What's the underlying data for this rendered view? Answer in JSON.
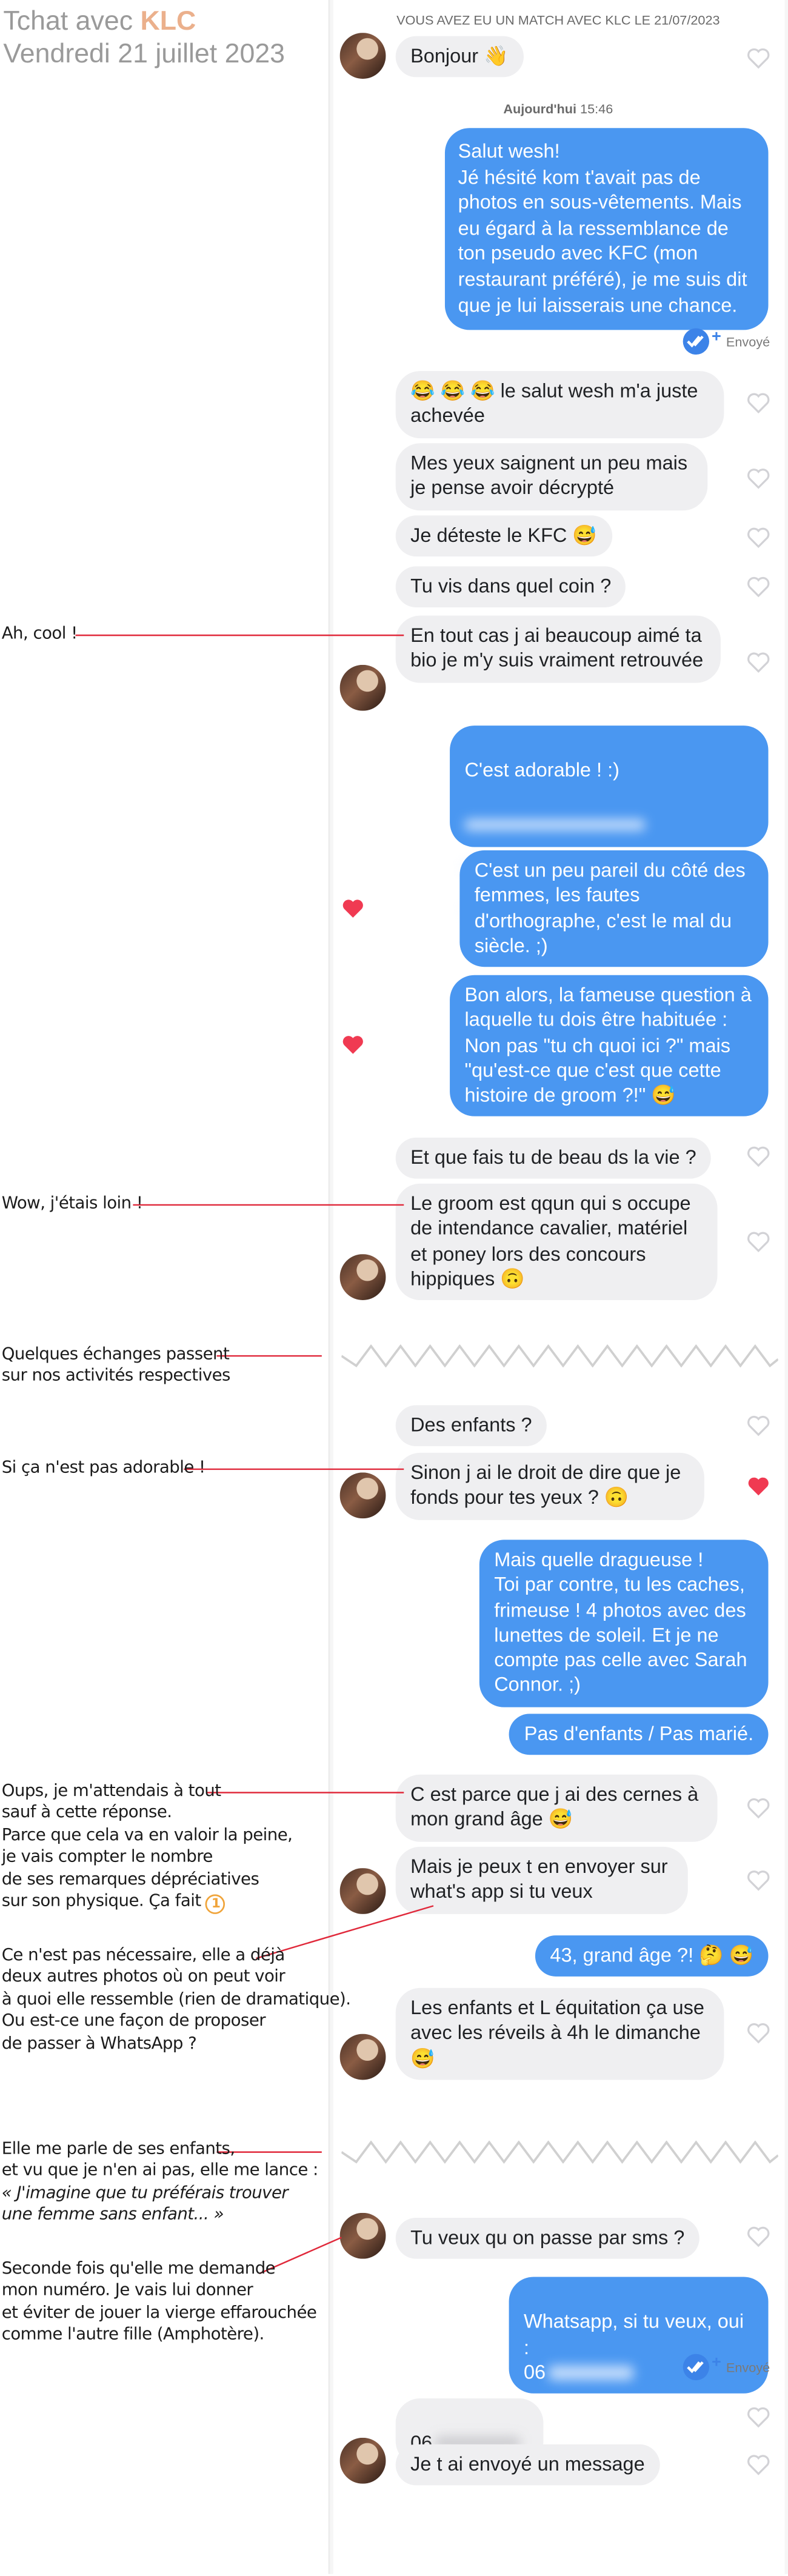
{
  "header": {
    "title_prefix": "Tchat avec",
    "title_name": "KLC",
    "date": "Vendredi 21 juillet 2023"
  },
  "chat": {
    "match_notice": "VOUS AVEZ EU UN MATCH AVEC KLC LE 21/07/2023",
    "today_label": "Aujourd'hui",
    "today_time": "15:46",
    "sent_status": "Envoyé",
    "messages": [
      {
        "dir": "in",
        "text": "Bonjour 👋"
      },
      {
        "dir": "out",
        "text": "Salut wesh!\nJé hésité kom t'avait pas de photos en sous-vêtements. Mais eu égard à la ressemblance de ton pseudo avec KFC (mon restaurant préféré), je me suis dit que je lui laisserais une chance."
      },
      {
        "dir": "in",
        "text": "😂 😂 😂 le salut wesh m'a juste achevée"
      },
      {
        "dir": "in",
        "text": "Mes yeux saignent un peu mais je pense avoir décrypté"
      },
      {
        "dir": "in",
        "text": "Je déteste le KFC 😅"
      },
      {
        "dir": "in",
        "text": "Tu vis dans quel coin ?"
      },
      {
        "dir": "in",
        "text": "En tout cas j ai beaucoup aimé ta bio je m'y suis vraiment retrouvée"
      },
      {
        "dir": "out",
        "text": "C'est adorable ! :)"
      },
      {
        "dir": "out",
        "text": "C'est un peu pareil du côté des femmes, les fautes d'orthographe, c'est le mal du siècle. ;)"
      },
      {
        "dir": "out",
        "text": "Bon alors, la fameuse question à laquelle tu dois être habituée : Non pas \"tu ch quoi ici ?\" mais \"qu'est-ce que c'est que cette histoire de groom ?!\" 😅"
      },
      {
        "dir": "in",
        "text": "Et que fais tu de beau ds la vie ?"
      },
      {
        "dir": "in",
        "text": "Le groom est qqun qui s occupe de intendance cavalier,  matériel et poney lors des concours hippiques 🙃"
      },
      {
        "dir": "in",
        "text": "Des enfants ?"
      },
      {
        "dir": "in",
        "text": "Sinon j ai le droit de dire que je fonds pour tes yeux ? 🙃"
      },
      {
        "dir": "out",
        "text": "Mais quelle dragueuse !\nToi par contre, tu les caches, frimeuse ! 4 photos avec des lunettes de soleil. Et je ne compte pas celle avec Sarah Connor. ;)"
      },
      {
        "dir": "out",
        "text": "Pas d'enfants / Pas marié."
      },
      {
        "dir": "in",
        "text": "C est parce que j ai des cernes à mon grand âge 😅"
      },
      {
        "dir": "in",
        "text": "Mais je peux t en envoyer sur what's app si tu veux"
      },
      {
        "dir": "out",
        "text": "43, grand âge ?! 🤔 😅"
      },
      {
        "dir": "in",
        "text": "Les enfants et L équitation ça use avec les réveils à 4h le dimanche 😅"
      },
      {
        "dir": "in",
        "text": "Tu veux qu on passe par sms ?"
      },
      {
        "dir": "out",
        "text": "Whatsapp, si tu veux, oui :\n06"
      },
      {
        "dir": "in",
        "text": "06"
      },
      {
        "dir": "in",
        "text": "Je t ai envoyé un message"
      }
    ]
  },
  "annotations": [
    {
      "text": "Ah, cool !"
    },
    {
      "text": "Wow, j'étais loin !"
    },
    {
      "text": "Quelques échanges passent\nsur nos activités respectives"
    },
    {
      "text": "Si ça n'est pas adorable !"
    },
    {
      "text": "Oups, je m'attendais à tout\nsauf à cette réponse.\nParce que cela va en valoir la peine,\nje vais compter le nombre\nde ses remarques dépréciatives\nsur son physique. Ça fait"
    },
    {
      "text": "Ce n'est pas nécessaire, elle a déjà\ndeux autres photos où on peut voir\nà quoi elle ressemble (rien de dramatique).\nOu est-ce une façon de proposer\nde passer à WhatsApp ?"
    },
    {
      "text": "Elle me parle de ses enfants,\net vu que je n'en ai pas, elle me lance :"
    },
    {
      "text": "« J'imagine que tu préférais trouver\nune femme sans enfant... »"
    },
    {
      "text": "Seconde fois qu'elle me demande\nmon numéro. Je vais lui donner\net éviter de jouer la vierge effarouchée\ncomme l'autre fille (Amphotère)."
    }
  ],
  "counter_badge": "1",
  "colors": {
    "accent": "#ebb08c",
    "bubble_out": "#4a97f1",
    "bubble_in": "#efeff1",
    "heart_liked": "#f03a52",
    "connector": "#e0283a"
  }
}
